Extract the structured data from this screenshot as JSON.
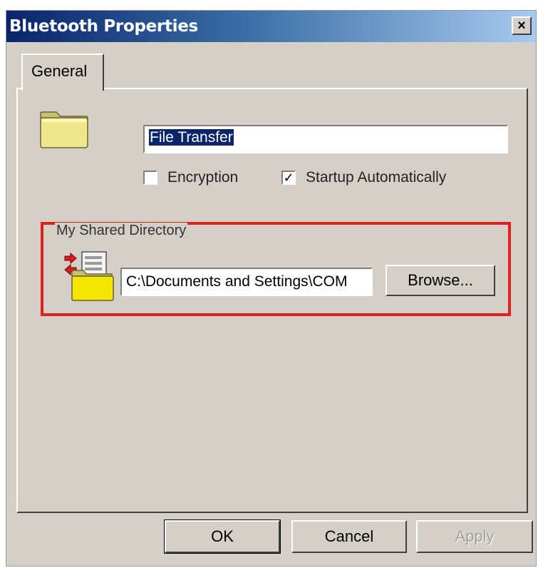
{
  "window": {
    "title": "Bluetooth Properties",
    "close_label": "×"
  },
  "tabs": [
    {
      "label": "General",
      "active": true
    }
  ],
  "general": {
    "service_name": "File Transfer",
    "encryption": {
      "label": "Encryption",
      "checked": false
    },
    "startup": {
      "label": "Startup Automatically",
      "checked": true
    },
    "shared_directory": {
      "group_label": "My Shared Directory",
      "path": "C:\\Documents and Settings\\COM",
      "browse_label": "Browse..."
    }
  },
  "footer": {
    "ok_label": "OK",
    "cancel_label": "Cancel",
    "apply_label": "Apply",
    "apply_enabled": false
  },
  "icons": {
    "folder": "folder-icon",
    "share": "shared-folder-transfer-icon",
    "check": "✓"
  },
  "colors": {
    "highlight": "#e02020",
    "title_start": "#0a246a",
    "title_end": "#a6caf0",
    "dialog_bg": "#d4d0c8",
    "folder_yellow": "#f0e68c"
  }
}
